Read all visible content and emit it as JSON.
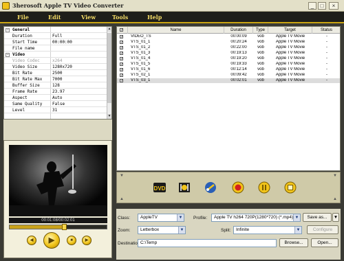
{
  "window": {
    "title": "3herosoft Apple TV Video Converter",
    "controls": [
      "_",
      "□",
      "×"
    ]
  },
  "menu": [
    "File",
    "Edit",
    "View",
    "Tools",
    "Help"
  ],
  "properties": [
    {
      "section": "General"
    },
    {
      "key": "Duration",
      "value": "Full"
    },
    {
      "key": "Start Time",
      "value": "00:00:00"
    },
    {
      "key": "File name",
      "value": ""
    },
    {
      "section": "Video"
    },
    {
      "key": "Video Codec",
      "value": "x264",
      "disabled": true
    },
    {
      "key": "Video Size",
      "value": "1280x720"
    },
    {
      "key": "Bit Rate",
      "value": "2500"
    },
    {
      "key": "Bit Rate Max",
      "value": "7000"
    },
    {
      "key": "Buffer Size",
      "value": "128"
    },
    {
      "key": "Frame Rate",
      "value": "23.97"
    },
    {
      "key": "Aspect",
      "value": "Auto"
    },
    {
      "key": "Same Quality",
      "value": "False"
    },
    {
      "key": "Level",
      "value": "31"
    }
  ],
  "preview": {
    "time": "00:01:08/00:02:01",
    "progress": 0.56
  },
  "file_list": {
    "columns": [
      "Name",
      "Duration",
      "Type",
      "Target",
      "Status"
    ],
    "rows": [
      {
        "name": "VIDEO_TS",
        "duration": "00:00:09",
        "type": "vob",
        "target": "Apple TV Movie",
        "status": "-"
      },
      {
        "name": "VTS_01_1",
        "duration": "00:20:24",
        "type": "vob",
        "target": "Apple TV Movie",
        "status": "-"
      },
      {
        "name": "VTS_01_2",
        "duration": "00:22:00",
        "type": "vob",
        "target": "Apple TV Movie",
        "status": "-"
      },
      {
        "name": "VTS_01_3",
        "duration": "00:19:13",
        "type": "vob",
        "target": "Apple TV Movie",
        "status": "-"
      },
      {
        "name": "VTS_01_4",
        "duration": "00:19:20",
        "type": "vob",
        "target": "Apple TV Movie",
        "status": "-"
      },
      {
        "name": "VTS_01_5",
        "duration": "00:19:33",
        "type": "vob",
        "target": "Apple TV Movie",
        "status": "-"
      },
      {
        "name": "VTS_01_6",
        "duration": "00:12:14",
        "type": "vob",
        "target": "Apple TV Movie",
        "status": "-"
      },
      {
        "name": "VTS_02_1",
        "duration": "00:09:42",
        "type": "vob",
        "target": "Apple TV Movie",
        "status": "-"
      },
      {
        "name": "VTS_03_1",
        "duration": "00:02:01",
        "type": "vob",
        "target": "Apple TV Movie",
        "status": "-",
        "selected": true
      }
    ]
  },
  "form": {
    "class_label": "Class:",
    "class_value": "AppleTV",
    "profile_label": "Profile:",
    "profile_value": "Apple TV h264 720P(1280*720)  (*.mp4)",
    "save_as": "Save as...",
    "zoom_label": "Zoom:",
    "zoom_value": "Letterbox",
    "split_label": "Split:",
    "split_value": "Infinite",
    "configure": "Configure",
    "destination_label": "Destination:",
    "destination_value": "C:\\Temp",
    "browse": "Browse...",
    "open": "Open..."
  },
  "colors": {
    "accent": "#f1c41a",
    "menubar": "#1e1e1a",
    "frame": "#3a3a34"
  },
  "icons": [
    "add-dvd-icon",
    "add-file-icon",
    "settings-icon",
    "convert-icon",
    "pause-icon",
    "stop-icon",
    "play-icon",
    "prev-icon",
    "next-icon"
  ]
}
